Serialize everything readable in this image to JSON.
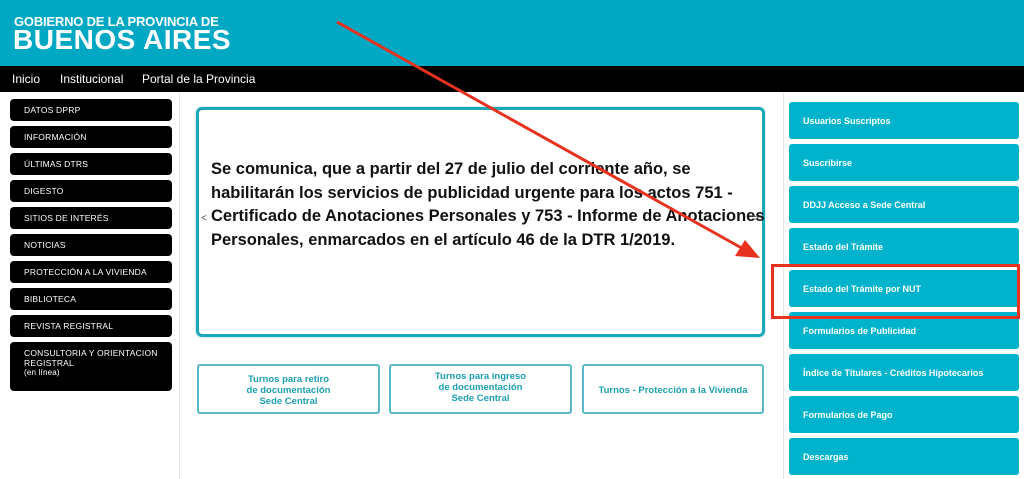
{
  "header": {
    "line1": "GOBIERNO DE LA PROVINCIA DE",
    "line2": "BUENOS AIRES"
  },
  "topnav": [
    "Inicio",
    "Institucional",
    "Portal de la Provincia"
  ],
  "left_menu": [
    "DATOS DPRP",
    "INFORMACIÓN",
    "ÚLTIMAS DTRS",
    "DIGESTO",
    "SITIOS DE INTERÉS",
    "NOTICIAS",
    "PROTECCIÓN A LA VIVIENDA",
    "BIBLIOTECA",
    "REVISTA REGISTRAL"
  ],
  "left_menu_last": {
    "line1": "CONSULTORIA Y ORIENTACION",
    "line2": "REGISTRAL",
    "line3": "(en línea)"
  },
  "carousel": {
    "text": "Se comunica, que a partir del 27 de julio del corriente año, se habilitarán los servicios de publicidad urgente para los actos 751 - Certificado de Anotaciones Personales  y 753 - Informe de Anotaciones Personales, enmarcados en el artículo 46 de la DTR 1/2019.",
    "prev": "<",
    "next": ">"
  },
  "turnos": [
    {
      "l1": "Turnos para retiro",
      "l2": "de documentación",
      "l3": "Sede Central"
    },
    {
      "l1": "Turnos para ingreso",
      "l2": "de documentación",
      "l3": "Sede Central"
    },
    {
      "l1": "Turnos - Protección a la Vivienda"
    }
  ],
  "right_menu": [
    "Usuarios Suscriptos",
    "Suscribirse",
    "DDJJ Acceso a Sede Central",
    "Estado del Trámite",
    "Estado del Trámite por NUT",
    "Formularios de Publicidad",
    "Índice de Titulares - Créditos Hipotecarios",
    "Formularios de Pago",
    "Descargas"
  ],
  "colors": {
    "brand": "#00a8c4",
    "button": "#00b3cc",
    "annotation": "#e8321f"
  }
}
